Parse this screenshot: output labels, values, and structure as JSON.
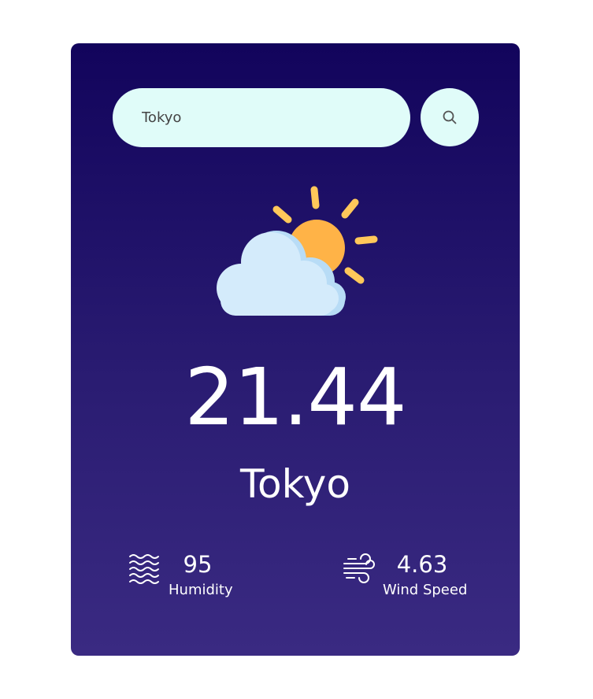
{
  "search": {
    "value": "Tokyo",
    "button_icon": "search-icon"
  },
  "weather": {
    "icon": "partly-cloudy-icon",
    "temperature": "21.44",
    "city": "Tokyo"
  },
  "stats": {
    "humidity": {
      "value": "95",
      "label": "Humidity",
      "icon": "humidity-waves-icon"
    },
    "wind": {
      "value": "4.63",
      "label": "Wind Speed",
      "icon": "wind-icon"
    }
  },
  "colors": {
    "card_gradient_top": "#12045c",
    "card_gradient_bottom": "#3a2a82",
    "input_background": "#e0fcf9",
    "sun": "#ffb347",
    "cloud": "#d4ebfb"
  }
}
